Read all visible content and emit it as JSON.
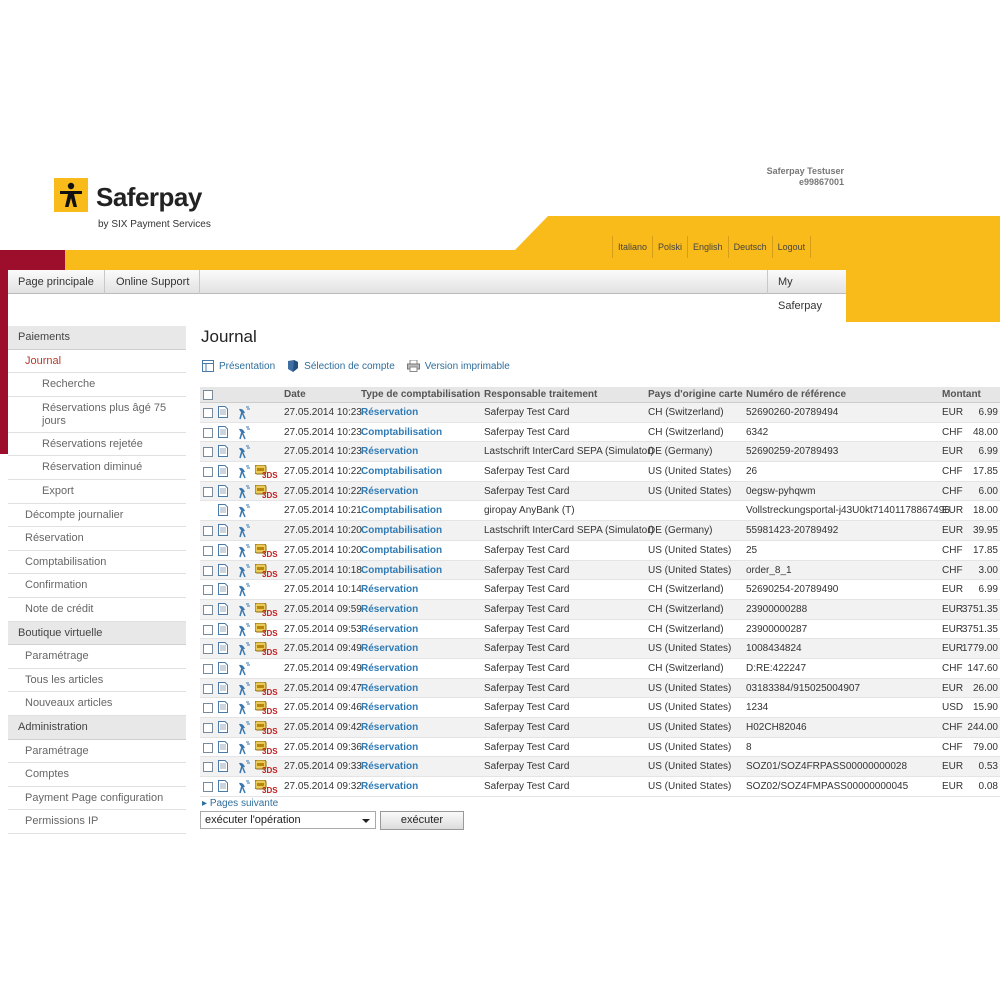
{
  "brand": {
    "name": "Saferpay",
    "subtitle": "by SIX Payment Services"
  },
  "user": {
    "name": "Saferpay Testuser",
    "id": "e99867001"
  },
  "colors": {
    "brand_yellow": "#f9bb1a",
    "brand_red": "#9c0e2c",
    "link_blue": "#2f7bb6"
  },
  "languages": [
    "Italiano",
    "Polski",
    "English",
    "Deutsch",
    "Logout"
  ],
  "nav": {
    "home": "Page principale",
    "support": "Online Support",
    "my": "My Saferpay"
  },
  "sidebar": {
    "payments": "Paiements",
    "journal": "Journal",
    "search": "Recherche",
    "older_reservations": "Réservations plus âgé 75 jours",
    "rejected": "Réservations rejetée",
    "reduced": "Réservation diminué",
    "export": "Export",
    "daily_statement": "Décompte journalier",
    "reservation": "Réservation",
    "accounting": "Comptabilisation",
    "confirmation": "Confirmation",
    "credit_note": "Note de crédit",
    "shop": "Boutique virtuelle",
    "shop_settings": "Paramétrage",
    "all_articles": "Tous les articles",
    "new_articles": "Nouveaux articles",
    "administration": "Administration",
    "admin_settings": "Paramétrage",
    "accounts": "Comptes",
    "payment_page": "Payment Page configuration",
    "ip_permissions": "Permissions IP"
  },
  "main": {
    "title": "Journal",
    "toolbar": {
      "presentation": "Présentation",
      "account_selection": "Sélection de compte",
      "print_version": "Version imprimable"
    },
    "columns": {
      "date": "Date",
      "type": "Type de comptabilisation",
      "responsible": "Responsable traitement",
      "country": "Pays d'origine carte",
      "reference": "Numéro de référence",
      "amount": "Montant"
    },
    "rows": [
      {
        "date": "27.05.2014 10:23",
        "type": "Réservation",
        "responsible": "Saferpay Test Card",
        "country": "CH (Switzerland)",
        "reference": "52690260-20789494",
        "currency": "EUR",
        "amount": "6.99",
        "secure3d": false,
        "checkbox": true
      },
      {
        "date": "27.05.2014 10:23",
        "type": "Comptabilisation",
        "responsible": "Saferpay Test Card",
        "country": "CH (Switzerland)",
        "reference": "6342",
        "currency": "CHF",
        "amount": "48.00",
        "secure3d": false,
        "checkbox": true
      },
      {
        "date": "27.05.2014 10:23",
        "type": "Réservation",
        "responsible": "Lastschrift InterCard SEPA (Simulator)",
        "country": "DE (Germany)",
        "reference": "52690259-20789493",
        "currency": "EUR",
        "amount": "6.99",
        "secure3d": false,
        "checkbox": true
      },
      {
        "date": "27.05.2014 10:22",
        "type": "Comptabilisation",
        "responsible": "Saferpay Test Card",
        "country": "US (United States)",
        "reference": "26",
        "currency": "CHF",
        "amount": "17.85",
        "secure3d": true,
        "checkbox": true
      },
      {
        "date": "27.05.2014 10:22",
        "type": "Réservation",
        "responsible": "Saferpay Test Card",
        "country": "US (United States)",
        "reference": "0egsw-pyhqwm",
        "currency": "CHF",
        "amount": "6.00",
        "secure3d": true,
        "checkbox": true
      },
      {
        "date": "27.05.2014 10:21",
        "type": "Comptabilisation",
        "responsible": "giropay AnyBank (T)",
        "country": "",
        "reference": "Vollstreckungsportal-j43U0kt71401178867496",
        "currency": "EUR",
        "amount": "18.00",
        "secure3d": false,
        "checkbox": false
      },
      {
        "date": "27.05.2014 10:20",
        "type": "Comptabilisation",
        "responsible": "Lastschrift InterCard SEPA (Simulator)",
        "country": "DE (Germany)",
        "reference": "55981423-20789492",
        "currency": "EUR",
        "amount": "39.95",
        "secure3d": false,
        "checkbox": true
      },
      {
        "date": "27.05.2014 10:20",
        "type": "Comptabilisation",
        "responsible": "Saferpay Test Card",
        "country": "US (United States)",
        "reference": "25",
        "currency": "CHF",
        "amount": "17.85",
        "secure3d": true,
        "checkbox": true
      },
      {
        "date": "27.05.2014 10:18",
        "type": "Comptabilisation",
        "responsible": "Saferpay Test Card",
        "country": "US (United States)",
        "reference": "order_8_1",
        "currency": "CHF",
        "amount": "3.00",
        "secure3d": true,
        "checkbox": true
      },
      {
        "date": "27.05.2014 10:14",
        "type": "Réservation",
        "responsible": "Saferpay Test Card",
        "country": "CH (Switzerland)",
        "reference": "52690254-20789490",
        "currency": "EUR",
        "amount": "6.99",
        "secure3d": false,
        "checkbox": true
      },
      {
        "date": "27.05.2014 09:59",
        "type": "Réservation",
        "responsible": "Saferpay Test Card",
        "country": "CH (Switzerland)",
        "reference": "23900000288",
        "currency": "EUR",
        "amount": "3751.35",
        "secure3d": true,
        "checkbox": true
      },
      {
        "date": "27.05.2014 09:53",
        "type": "Réservation",
        "responsible": "Saferpay Test Card",
        "country": "CH (Switzerland)",
        "reference": "23900000287",
        "currency": "EUR",
        "amount": "3751.35",
        "secure3d": true,
        "checkbox": true
      },
      {
        "date": "27.05.2014 09:49",
        "type": "Réservation",
        "responsible": "Saferpay Test Card",
        "country": "US (United States)",
        "reference": "1008434824",
        "currency": "EUR",
        "amount": "1779.00",
        "secure3d": true,
        "checkbox": true
      },
      {
        "date": "27.05.2014 09:49",
        "type": "Réservation",
        "responsible": "Saferpay Test Card",
        "country": "CH (Switzerland)",
        "reference": "D:RE:422247",
        "currency": "CHF",
        "amount": "147.60",
        "secure3d": false,
        "checkbox": true
      },
      {
        "date": "27.05.2014 09:47",
        "type": "Réservation",
        "responsible": "Saferpay Test Card",
        "country": "US (United States)",
        "reference": "03183384/915025004907",
        "currency": "EUR",
        "amount": "26.00",
        "secure3d": true,
        "checkbox": true
      },
      {
        "date": "27.05.2014 09:46",
        "type": "Réservation",
        "responsible": "Saferpay Test Card",
        "country": "US (United States)",
        "reference": "1234",
        "currency": "USD",
        "amount": "15.90",
        "secure3d": true,
        "checkbox": true
      },
      {
        "date": "27.05.2014 09:42",
        "type": "Réservation",
        "responsible": "Saferpay Test Card",
        "country": "US (United States)",
        "reference": "H02CH82046",
        "currency": "CHF",
        "amount": "244.00",
        "secure3d": true,
        "checkbox": true
      },
      {
        "date": "27.05.2014 09:36",
        "type": "Réservation",
        "responsible": "Saferpay Test Card",
        "country": "US (United States)",
        "reference": "8",
        "currency": "CHF",
        "amount": "79.00",
        "secure3d": true,
        "checkbox": true
      },
      {
        "date": "27.05.2014 09:33",
        "type": "Réservation",
        "responsible": "Saferpay Test Card",
        "country": "US (United States)",
        "reference": "SOZ01/SOZ4FRPASS00000000028",
        "currency": "EUR",
        "amount": "0.53",
        "secure3d": true,
        "checkbox": true
      },
      {
        "date": "27.05.2014 09:32",
        "type": "Réservation",
        "responsible": "Saferpay Test Card",
        "country": "US (United States)",
        "reference": "SOZ02/SOZ4FMPASS00000000045",
        "currency": "EUR",
        "amount": "0.08",
        "secure3d": true,
        "checkbox": true
      }
    ],
    "pages_next": "Pages suivante",
    "operation_select": "exécuter l'opération",
    "execute_button": "exécuter"
  },
  "icons": {
    "row_detail": "document-icon",
    "row_transaction": "satellite-dish-icon",
    "row_3ds": "3ds-badge-icon"
  }
}
